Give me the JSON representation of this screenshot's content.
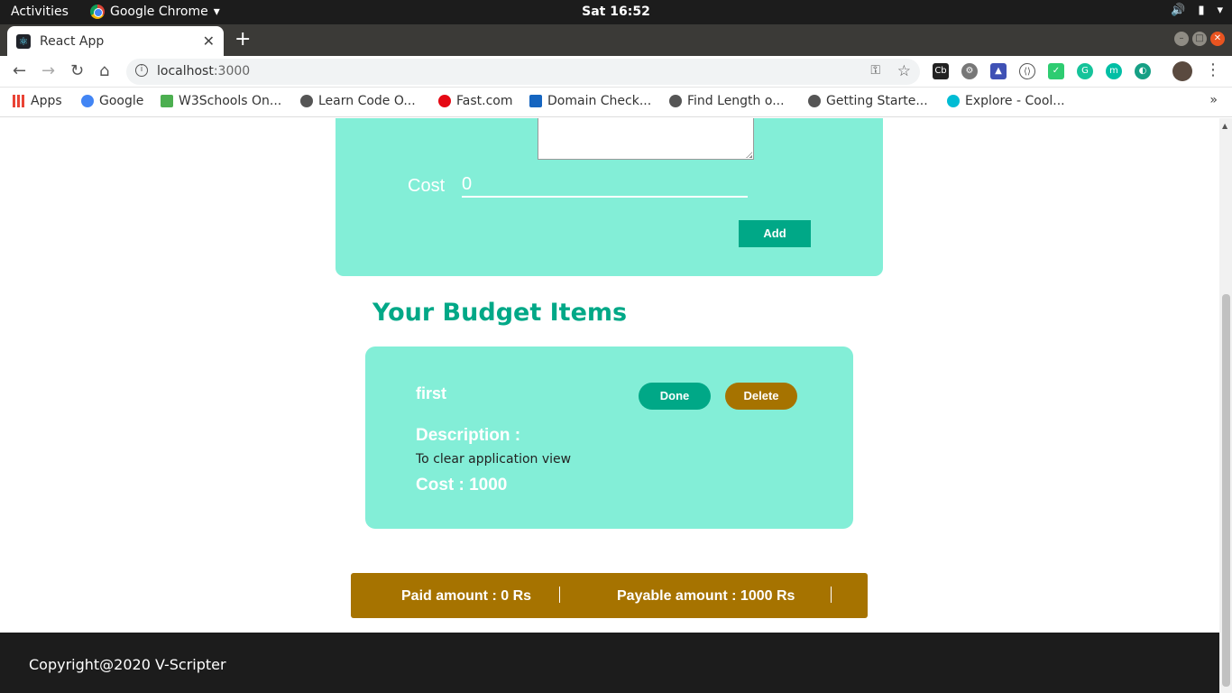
{
  "system_bar": {
    "activities": "Activities",
    "app_name": "Google Chrome",
    "clock": "Sat 16:52"
  },
  "browser": {
    "tab_title": "React App",
    "url_host": "localhost",
    "url_port": ":3000",
    "bookmarks": [
      {
        "label": "Apps",
        "color": "#e94335"
      },
      {
        "label": "Google",
        "color": "#4285f4"
      },
      {
        "label": "W3Schools On...",
        "color": "#4caf50"
      },
      {
        "label": "Learn Code O...",
        "color": "#555555"
      },
      {
        "label": "Fast.com",
        "color": "#e50914"
      },
      {
        "label": "Domain Check...",
        "color": "#1565c0"
      },
      {
        "label": "Find Length o...",
        "color": "#555555"
      },
      {
        "label": "Getting Starte...",
        "color": "#555555"
      },
      {
        "label": "Explore - Cool...",
        "color": "#00bcd4"
      }
    ]
  },
  "form": {
    "cost_label": "Cost",
    "cost_value": "0",
    "add_label": "Add"
  },
  "budget": {
    "title": "Your Budget Items",
    "items": [
      {
        "name": "first",
        "done_label": "Done",
        "delete_label": "Delete",
        "description_label": "Description :",
        "description": "To clear application view",
        "cost_text": "Cost : 1000"
      }
    ]
  },
  "summary": {
    "paid": "Paid amount : 0 Rs",
    "payable": "Payable amount : 1000 Rs"
  },
  "footer": {
    "copyright": "Copyright@2020 V-Scripter"
  },
  "colors": {
    "card_bg": "#83eed7",
    "primary": "#00a887",
    "accent": "#a67300",
    "footer_bg": "#1c1c1c"
  }
}
